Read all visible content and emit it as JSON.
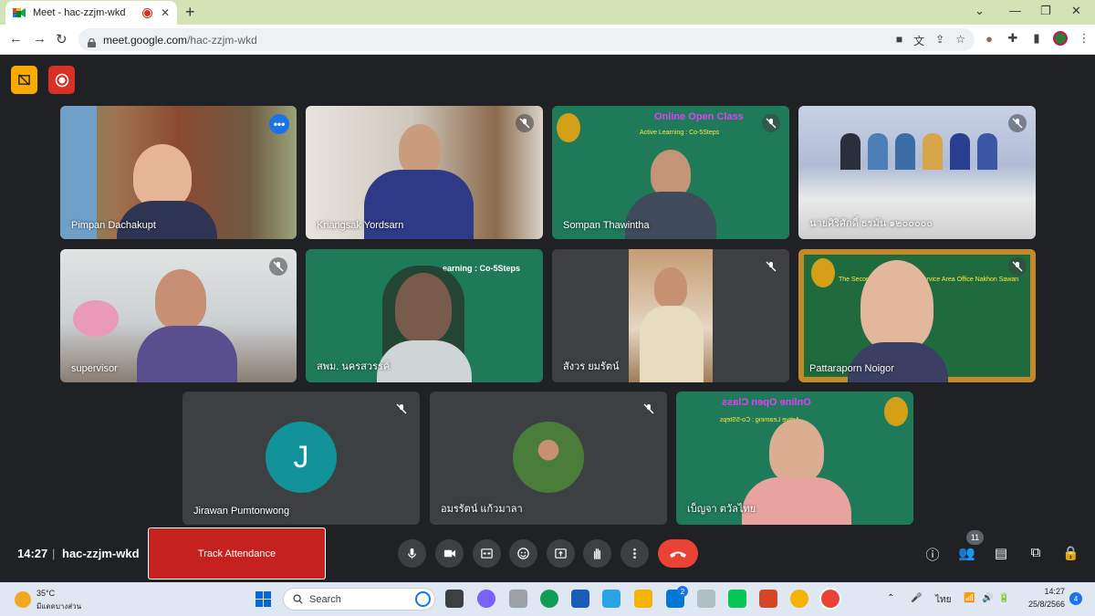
{
  "browser": {
    "tab_title": "Meet - hac-zzjm-wkd",
    "new_tab_symbol": "+",
    "url_host": "meet.google.com",
    "url_path": "/hac-zzjm-wkd"
  },
  "meet": {
    "tiles": [
      {
        "name": "Pimpan Dachakupt"
      },
      {
        "name": "Kriangsak Yordsarn"
      },
      {
        "name": "Sompan Thawintha",
        "banner_title": "Online Open Class",
        "banner_sub": "Active Learning : Co-5Steps"
      },
      {
        "name": "นายศิริศักดิ์ ธรมัน ๑๒๐๐๐๐๐"
      },
      {
        "name": "supervisor"
      },
      {
        "name": "สพม. นครสวรรค์",
        "banner_sub": "earning : Co-5Steps"
      },
      {
        "name": "สังวร ยมรัตน์"
      },
      {
        "name": "Pattaraporn Noigor",
        "banner_sub": "The Secondary Educational Service Area Office Nakhon Sawan"
      },
      {
        "name": "Jirawan Pumtonwong",
        "avatar_letter": "J"
      },
      {
        "name": "อมรรัตน์ แก้วมาลา"
      },
      {
        "name": "เบ็ญจา ตวัลไทย",
        "banner_title": "Online Open Class",
        "banner_sub": "Active Learning : Co-5Steps"
      }
    ]
  },
  "bottom_bar": {
    "time": "14:27",
    "separator": "|",
    "meeting_code": "hac-zzjm-wkd",
    "track_attendance": "Track Attendance",
    "participant_count": "11"
  },
  "taskbar": {
    "temperature": "35°C",
    "weather_desc": "มีแดดบางส่วน",
    "search_label": "Search",
    "language": "ไทย",
    "time": "14:27",
    "date": "25/8/2566",
    "notification_count": "4",
    "mail_badge": "2"
  }
}
